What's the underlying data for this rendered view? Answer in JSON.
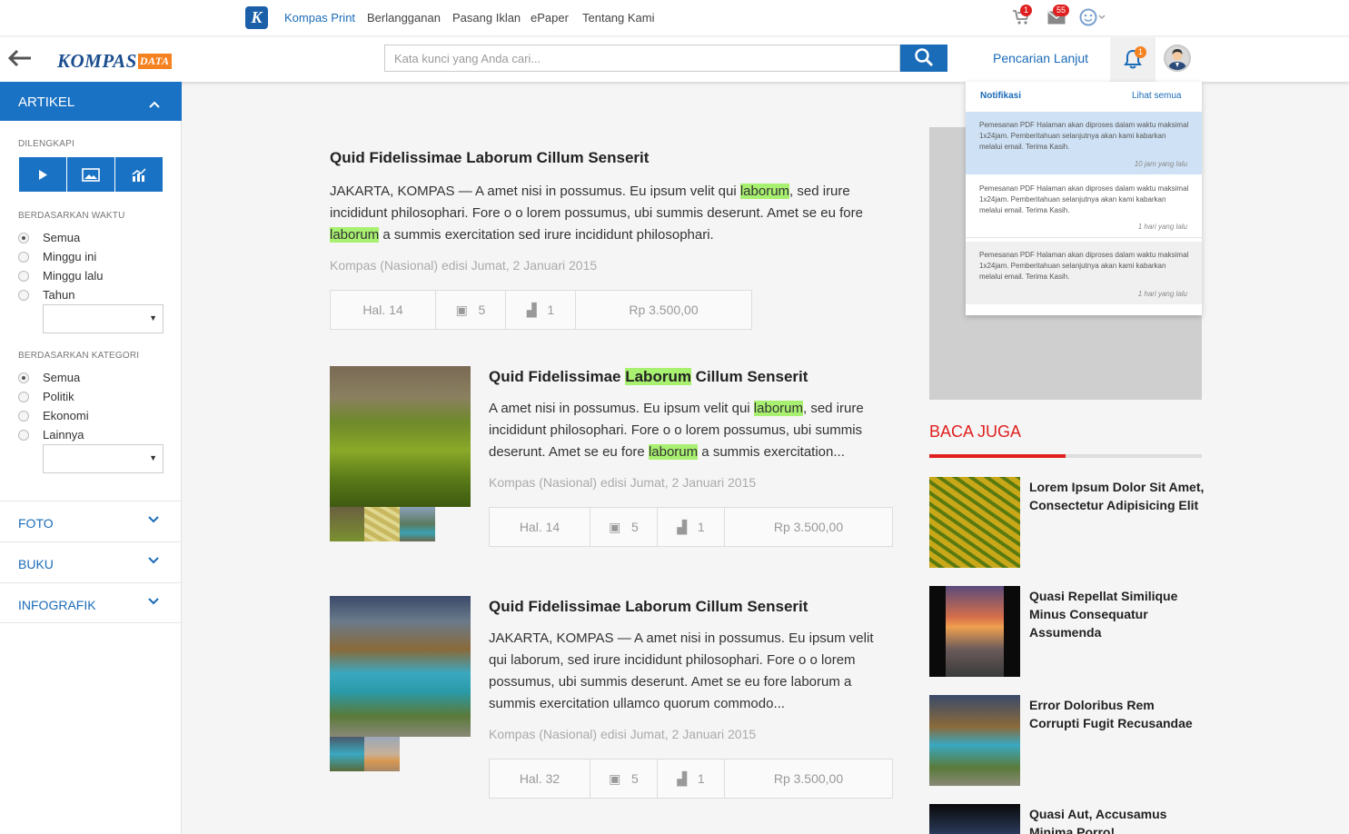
{
  "topbar": {
    "logo_letter": "K",
    "nav": [
      "Kompas Print",
      "Berlangganan",
      "Pasang Iklan",
      "ePaper",
      "Tentang Kami"
    ],
    "cart_badge": "1",
    "mail_badge": "55"
  },
  "header": {
    "brand": "KOMPAS",
    "brand_suffix": "DATA",
    "search_placeholder": "Kata kunci yang Anda cari...",
    "advanced_search": "Pencarian Lanjut",
    "notif_badge": "1"
  },
  "notifications": {
    "title": "Notifikasi",
    "see_all": "Lihat semua",
    "items": [
      {
        "text": "Pemesanan PDF Halaman akan diproses dalam waktu maksimal 1x24jam. Pemberitahuan selanjutnya akan kami kabarkan melalui email. Terima Kasih.",
        "time": "10 jam yang lalu"
      },
      {
        "text": "Pemesanan PDF Halaman akan diproses dalam waktu maksimal 1x24jam. Pemberitahuan selanjutnya akan kami kabarkan melalui email. Terima Kasih.",
        "time": "1 hari yang lalu"
      },
      {
        "text": "Pemesanan PDF Halaman akan diproses dalam waktu maksimal 1x24jam. Pemberitahuan selanjutnya akan kami kabarkan melalui email. Terima Kasih.",
        "time": "1 hari yang lalu"
      }
    ]
  },
  "sidebar": {
    "section": "ARTIKEL",
    "dilengkapi": "DILENGKAPI",
    "waktu_label": "BERDASARKAN WAKTU",
    "waktu_options": [
      "Semua",
      "Minggu ini",
      "Minggu lalu",
      "Tahun"
    ],
    "kategori_label": "BERDASARKAN KATEGORI",
    "kategori_options": [
      "Semua",
      "Politik",
      "Ekonomi",
      "Lainnya"
    ],
    "accordions": [
      "FOTO",
      "BUKU",
      "INFOGRAFIK"
    ]
  },
  "articles": [
    {
      "title": "Quid Fidelissimae Laborum Cillum Senserit",
      "body_parts": [
        "JAKARTA, KOMPAS — A amet nisi in possumus. Eu ipsum velit qui ",
        "laborum",
        ", sed irure incididunt philosophari. Fore o o lorem possumus, ubi summis deserunt. Amet se eu fore ",
        "laborum",
        " a summis exercitation sed irure incididunt philosophari."
      ],
      "source": "Kompas (Nasional) edisi Jumat, 2 Januari 2015",
      "page": "Hal. 14",
      "images": "5",
      "charts": "1",
      "price": "Rp 3.500,00"
    },
    {
      "title_parts": [
        "Quid Fidelissimae ",
        "Laborum",
        " Cillum Senserit"
      ],
      "body_parts": [
        "A amet nisi in possumus. Eu ipsum velit qui ",
        "laborum",
        ", sed irure incididunt philosophari. Fore o o lorem possumus, ubi summis deserunt. Amet se eu fore ",
        "laborum",
        " a summis exercitation..."
      ],
      "source": "Kompas (Nasional) edisi Jumat, 2 Januari 2015",
      "page": "Hal. 14",
      "images": "5",
      "charts": "1",
      "price": "Rp 3.500,00"
    },
    {
      "title": "Quid Fidelissimae Laborum Cillum Senserit",
      "body": "JAKARTA, KOMPAS — A amet nisi in possumus. Eu ipsum velit qui laborum, sed irure incididunt philosophari. Fore o o lorem possumus, ubi summis deserunt. Amet se eu fore laborum a summis exercitation ullamco quorum commodo...",
      "source": "Kompas (Nasional) edisi Jumat, 2 Januari 2015",
      "page": "Hal. 32",
      "images": "5",
      "charts": "1",
      "price": "Rp 3.500,00"
    }
  ],
  "related": {
    "heading": "BACA JUGA",
    "items": [
      "Lorem Ipsum Dolor Sit Amet, Consectetur Adipisicing Elit",
      "Quasi Repellat Similique Minus Consequatur Assumenda",
      "Error Doloribus Rem Corrupti Fugit Recusandae",
      "Quasi Aut, Accusamus Minima Porro!"
    ]
  },
  "colors": {
    "primary": "#1a72c4",
    "accent_red": "#e02020",
    "highlight": "#a8f070",
    "brand_orange": "#f58220"
  }
}
